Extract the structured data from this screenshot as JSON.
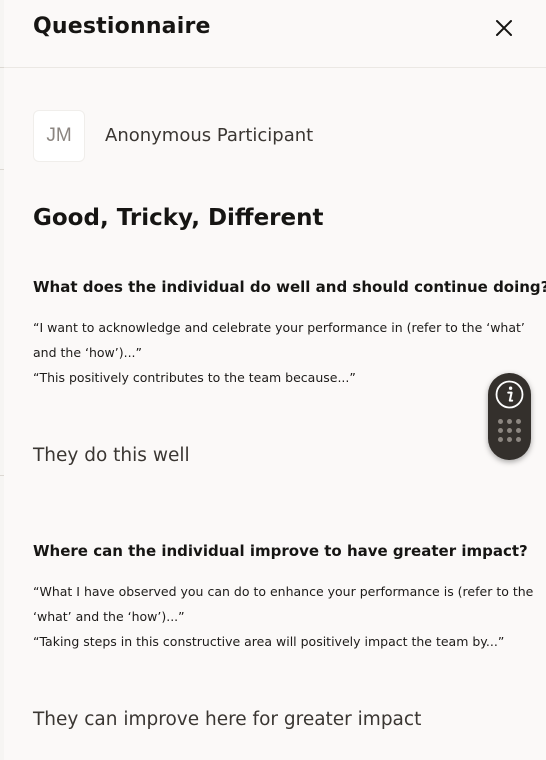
{
  "header": {
    "title": "Questionnaire"
  },
  "participant": {
    "initials": "JM",
    "name": "Anonymous Participant"
  },
  "section": {
    "title": "Good, Tricky, Different"
  },
  "questions": [
    {
      "question": "What does the individual do well and should continue doing?",
      "prompt_lines": [
        "“I want to acknowledge and celebrate your performance in (refer to the ‘what’",
        "and the ‘how’)...”",
        "“This positively contributes to the team because...”"
      ],
      "answer": "They do this well"
    },
    {
      "question": "Where can the individual improve to have greater impact?",
      "prompt_lines": [
        "“What I have observed you can do to enhance your performance is (refer to the",
        "‘what’ and the ‘how’)...”",
        "“Taking steps in this constructive area will positively impact the team by...”"
      ],
      "answer": "They can improve here for greater impact"
    }
  ],
  "icons": {
    "close": "close-icon",
    "info": "info-icon",
    "drag": "drag-handle-icon"
  },
  "colors": {
    "panel_background": "#fbf9f8",
    "text_primary": "#161513",
    "floating_toolbar": "#34302c"
  }
}
